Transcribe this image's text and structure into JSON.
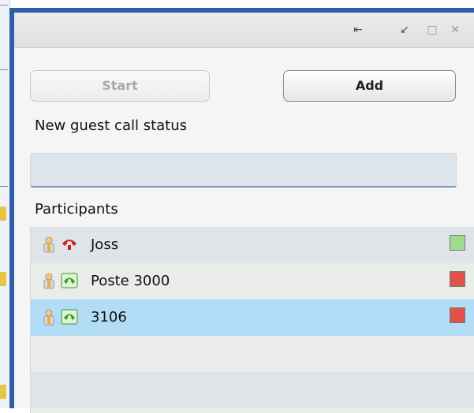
{
  "window": {
    "controls": [
      {
        "name": "pin-icon",
        "glyph": "⇤"
      },
      {
        "name": "dock-icon",
        "glyph": "↙"
      },
      {
        "name": "maximize-icon",
        "glyph": "□"
      },
      {
        "name": "close-icon",
        "glyph": "✕"
      }
    ]
  },
  "actions": {
    "start_label": "Start",
    "add_label": "Add"
  },
  "status": {
    "label": "New guest call status",
    "value": ""
  },
  "participants": {
    "label": "Participants",
    "rows": [
      {
        "name": "Joss",
        "call_state": "hung-up",
        "phone_color": "#cc2222",
        "status_color": "#9fdc8e"
      },
      {
        "name": "Poste 3000",
        "call_state": "active",
        "phone_color": "#3a9a2a",
        "status_color": "#e0524a"
      },
      {
        "name": "3106",
        "call_state": "active",
        "phone_color": "#3a9a2a",
        "status_color": "#e0524a",
        "selected": true
      }
    ],
    "empty_rows": 2
  },
  "colors": {
    "window_border": "#2e5fa8",
    "selected_row": "#b3dcf7"
  }
}
